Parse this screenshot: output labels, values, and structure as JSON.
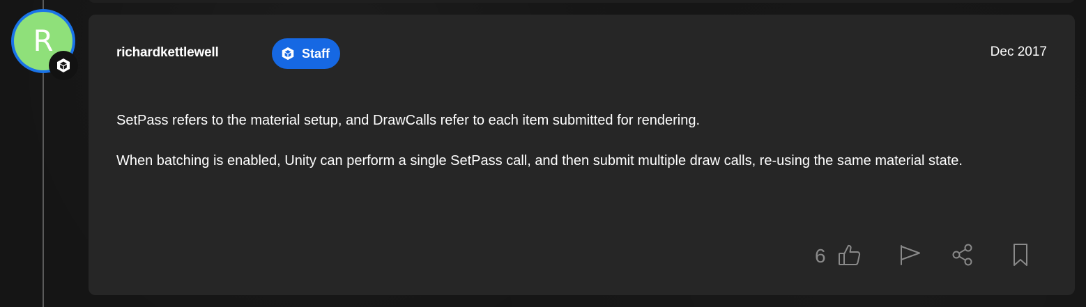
{
  "post": {
    "author": {
      "username": "richardkettlewell",
      "avatar_letter": "R",
      "avatar_color": "#8fe07a",
      "avatar_ring_color": "#1a73e8",
      "badge": {
        "label": "Staff",
        "color": "#1668e3",
        "icon": "unity-logo-icon"
      }
    },
    "date": "Dec 2017",
    "paragraphs": [
      "SetPass refers to the material setup, and DrawCalls refer to each item submitted for rendering.",
      "When batching is enabled, Unity can perform a single SetPass call, and then submit multiple draw calls, re-using the same material state."
    ],
    "actions": {
      "like_count": "6",
      "icons": [
        "thumbs-up-icon",
        "flag-icon",
        "share-icon",
        "bookmark-icon"
      ]
    }
  }
}
